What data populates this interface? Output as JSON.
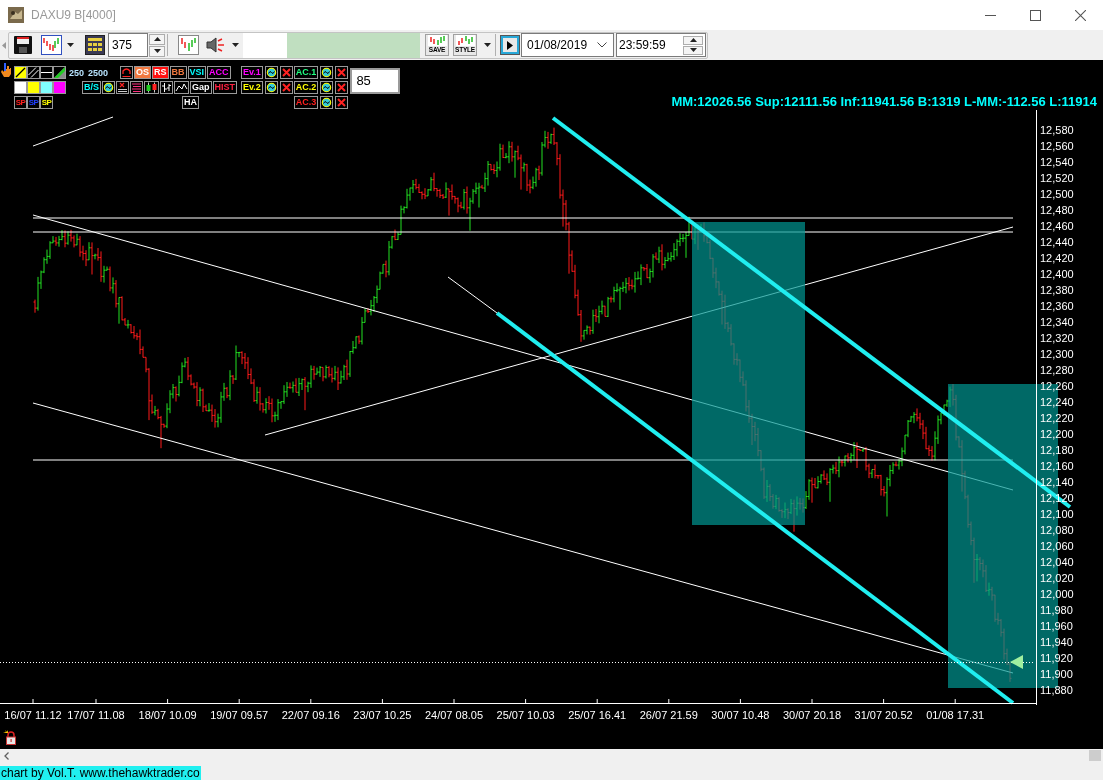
{
  "window": {
    "title": "DAXU9 B[4000]"
  },
  "toolbar": {
    "bar_count": "375",
    "save_label": "SAVE",
    "style_label": "STYLE",
    "date": "01/08/2019",
    "time": "23:59:59"
  },
  "indicator_panel": {
    "drawing_colors": [
      {
        "color": "#ffffff"
      },
      {
        "color": "#ffff00"
      },
      {
        "color": "#80ffff"
      },
      {
        "color": "#ff00ff"
      }
    ],
    "sp_buttons": [
      {
        "label": "SP",
        "color": "#ff2020"
      },
      {
        "label": "SP",
        "color": "#2040ff"
      },
      {
        "label": "SP",
        "color": "#ffff00"
      }
    ],
    "periods": [
      "250",
      "2500"
    ],
    "indicators": [
      {
        "label": "OS",
        "kind": "filled",
        "color": "#f07840"
      },
      {
        "label": "RS",
        "kind": "filled",
        "color": "#ff1010"
      },
      {
        "label": "BB",
        "kind": "outline",
        "color": "#f07840"
      },
      {
        "label": "VSI",
        "kind": "outline",
        "color": "#00ffff"
      },
      {
        "label": "ACC",
        "kind": "outline",
        "color": "#ff00ff"
      }
    ],
    "bs_button": {
      "label": "B/S",
      "color": "#00ffff"
    },
    "style_buttons": [
      {
        "label": "Gap",
        "color": "#ffffff"
      },
      {
        "label": "HIST",
        "color": "#ff2040"
      }
    ],
    "ha_button": {
      "label": "HA",
      "color": "#ffffff"
    },
    "events": [
      {
        "label": "Ev.1",
        "color": "#ff00ff"
      },
      {
        "label": "Ev.2",
        "color": "#ffff00"
      }
    ],
    "ac_levels": [
      {
        "label": "AC.1",
        "color": "#20ff80"
      },
      {
        "label": "AC.2",
        "color": "#ffff00"
      },
      {
        "label": "AC.3",
        "color": "#ff2020"
      }
    ],
    "value_field": "85"
  },
  "info": "MM:12026.56 Sup:12111.56 Inf:11941.56 B:1319 L-MM:-112.56 L:11914",
  "chart": {
    "y_labels": [
      "12,580",
      "12,560",
      "12,540",
      "12,520",
      "12,500",
      "12,480",
      "12,460",
      "12,440",
      "12,420",
      "12,400",
      "12,380",
      "12,360",
      "12,340",
      "12,320",
      "12,300",
      "12,280",
      "12,260",
      "12,240",
      "12,220",
      "12,200",
      "12,180",
      "12,160",
      "12,140",
      "12,120",
      "12,100",
      "12,080",
      "12,060",
      "12,040",
      "12,020",
      "12,000",
      "11,980",
      "11,960",
      "11,940",
      "11,920",
      "11,900",
      "11,880"
    ],
    "x_labels": [
      "16/07 11.12",
      "17/07 11.08",
      "18/07 10.09",
      "19/07 09.57",
      "22/07 09.16",
      "23/07 10.25",
      "24/07 08.05",
      "25/07 10.03",
      "25/07 16.41",
      "26/07 21.59",
      "30/07 10.48",
      "30/07 20.18",
      "31/07 20.52",
      "01/08 17.31"
    ]
  },
  "status_bar": {
    "credit": "chart by Vol.T. www.thehawktrader.co"
  }
}
